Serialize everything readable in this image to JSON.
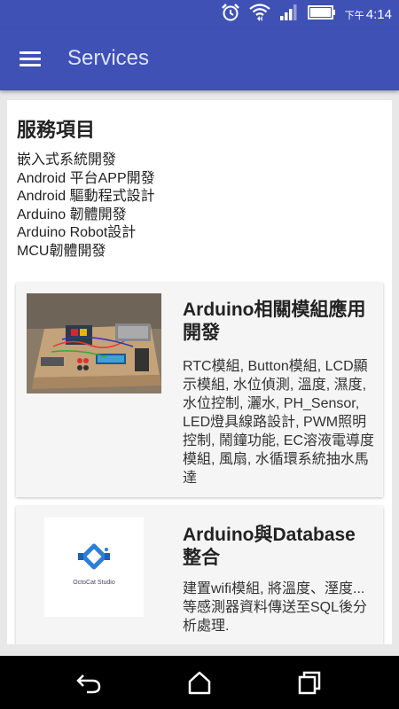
{
  "status_bar": {
    "ampm": "下午",
    "time": "4:14"
  },
  "app_bar": {
    "title": "Services"
  },
  "content": {
    "heading": "服務項目",
    "services": [
      "嵌入式系統開發",
      "Android 平台APP開發",
      "Android 驅動程式設計",
      "Arduino 韌體開發",
      "Arduino Robot設計",
      "MCU韌體開發"
    ],
    "cards": [
      {
        "title": "Arduino相關模組應用開發",
        "description": "RTC模組, Button模組, LCD顯示模組, 水位偵測, 溫度, 濕度, 水位控制, 灑水, PH_Sensor, LED燈具線路設計, PWM照明控制, 鬧鐘功能, EC溶液電導度模組, 風扇, 水循環系統抽水馬達"
      },
      {
        "title": "Arduino與Database整合",
        "description": "建置wifi模組, 將溫度、溼度...等感測器資料傳送至SQL後分析處理.",
        "logo_text": "OctoCat Studio"
      }
    ]
  },
  "colors": {
    "primary": "#3F51B5",
    "card_bg": "#f5f5f5",
    "page_bg": "#e8e8e8"
  }
}
